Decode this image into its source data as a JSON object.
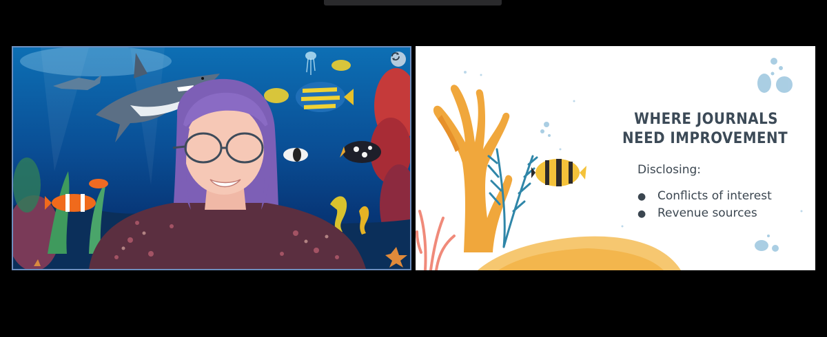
{
  "meeting": {
    "participant_video": {
      "switch_camera_icon": "camera-switch-icon",
      "colors": {
        "border": "#6d8fbf",
        "water_top": "#0d6fb4",
        "water_bottom": "#062a5e"
      }
    },
    "shared_slide": {
      "title_lines": [
        "WHERE JOURNALS",
        "NEED IMPROVEMENT"
      ],
      "subheading": "Disclosing:",
      "bullets": [
        "Conflicts of interest",
        "Revenue sources"
      ],
      "bullet_glyph": "●",
      "colors": {
        "title": "#3c4a57",
        "text": "#3b4650",
        "coral": "#f0a73c",
        "sand": "#f6c770"
      }
    }
  }
}
